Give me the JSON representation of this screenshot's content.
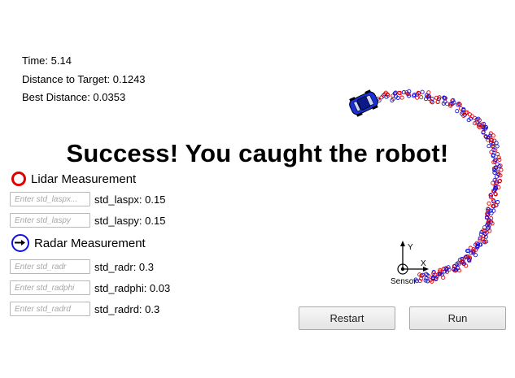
{
  "stats": {
    "time": "Time: 5.14",
    "distance": "Distance to Target: 0.1243",
    "best": "Best Distance: 0.0353"
  },
  "banner": "Success! You caught the robot!",
  "lidar": {
    "title": "Lidar Measurement",
    "color": "#e00000",
    "params": [
      {
        "placeholder": "Enter std_laspx...",
        "label": "std_laspx: 0.15"
      },
      {
        "placeholder": "Enter std_laspy",
        "label": "std_laspy: 0.15"
      }
    ]
  },
  "radar": {
    "title": "Radar Measurement",
    "color": "#1010e0",
    "params": [
      {
        "placeholder": "Enter std_radr",
        "label": "std_radr: 0.3"
      },
      {
        "placeholder": "Enter std_radphi",
        "label": "std_radphi: 0.03"
      },
      {
        "placeholder": "Enter std_radrd",
        "label": "std_radrd: 0.3"
      }
    ]
  },
  "buttons": {
    "restart": "Restart",
    "run": "Run"
  },
  "scene": {
    "axis_x": "X",
    "axis_y": "Y",
    "sensor": "Sensor",
    "car_icon": "car-icon",
    "car_color": "#1a2fd6"
  }
}
